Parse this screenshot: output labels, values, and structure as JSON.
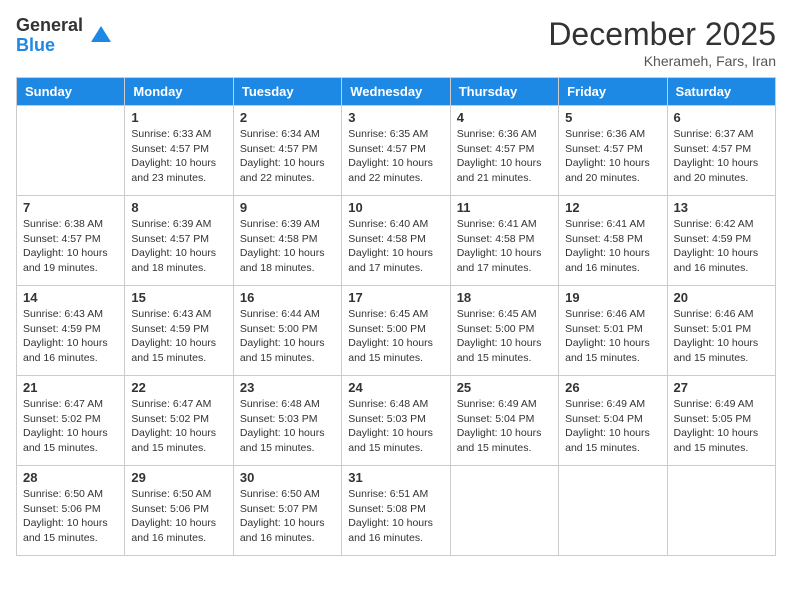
{
  "logo": {
    "general": "General",
    "blue": "Blue"
  },
  "header": {
    "month": "December 2025",
    "location": "Kherameh, Fars, Iran"
  },
  "days_of_week": [
    "Sunday",
    "Monday",
    "Tuesday",
    "Wednesday",
    "Thursday",
    "Friday",
    "Saturday"
  ],
  "weeks": [
    [
      {
        "day": "",
        "info": ""
      },
      {
        "day": "1",
        "info": "Sunrise: 6:33 AM\nSunset: 4:57 PM\nDaylight: 10 hours\nand 23 minutes."
      },
      {
        "day": "2",
        "info": "Sunrise: 6:34 AM\nSunset: 4:57 PM\nDaylight: 10 hours\nand 22 minutes."
      },
      {
        "day": "3",
        "info": "Sunrise: 6:35 AM\nSunset: 4:57 PM\nDaylight: 10 hours\nand 22 minutes."
      },
      {
        "day": "4",
        "info": "Sunrise: 6:36 AM\nSunset: 4:57 PM\nDaylight: 10 hours\nand 21 minutes."
      },
      {
        "day": "5",
        "info": "Sunrise: 6:36 AM\nSunset: 4:57 PM\nDaylight: 10 hours\nand 20 minutes."
      },
      {
        "day": "6",
        "info": "Sunrise: 6:37 AM\nSunset: 4:57 PM\nDaylight: 10 hours\nand 20 minutes."
      }
    ],
    [
      {
        "day": "7",
        "info": "Sunrise: 6:38 AM\nSunset: 4:57 PM\nDaylight: 10 hours\nand 19 minutes."
      },
      {
        "day": "8",
        "info": "Sunrise: 6:39 AM\nSunset: 4:57 PM\nDaylight: 10 hours\nand 18 minutes."
      },
      {
        "day": "9",
        "info": "Sunrise: 6:39 AM\nSunset: 4:58 PM\nDaylight: 10 hours\nand 18 minutes."
      },
      {
        "day": "10",
        "info": "Sunrise: 6:40 AM\nSunset: 4:58 PM\nDaylight: 10 hours\nand 17 minutes."
      },
      {
        "day": "11",
        "info": "Sunrise: 6:41 AM\nSunset: 4:58 PM\nDaylight: 10 hours\nand 17 minutes."
      },
      {
        "day": "12",
        "info": "Sunrise: 6:41 AM\nSunset: 4:58 PM\nDaylight: 10 hours\nand 16 minutes."
      },
      {
        "day": "13",
        "info": "Sunrise: 6:42 AM\nSunset: 4:59 PM\nDaylight: 10 hours\nand 16 minutes."
      }
    ],
    [
      {
        "day": "14",
        "info": "Sunrise: 6:43 AM\nSunset: 4:59 PM\nDaylight: 10 hours\nand 16 minutes."
      },
      {
        "day": "15",
        "info": "Sunrise: 6:43 AM\nSunset: 4:59 PM\nDaylight: 10 hours\nand 15 minutes."
      },
      {
        "day": "16",
        "info": "Sunrise: 6:44 AM\nSunset: 5:00 PM\nDaylight: 10 hours\nand 15 minutes."
      },
      {
        "day": "17",
        "info": "Sunrise: 6:45 AM\nSunset: 5:00 PM\nDaylight: 10 hours\nand 15 minutes."
      },
      {
        "day": "18",
        "info": "Sunrise: 6:45 AM\nSunset: 5:00 PM\nDaylight: 10 hours\nand 15 minutes."
      },
      {
        "day": "19",
        "info": "Sunrise: 6:46 AM\nSunset: 5:01 PM\nDaylight: 10 hours\nand 15 minutes."
      },
      {
        "day": "20",
        "info": "Sunrise: 6:46 AM\nSunset: 5:01 PM\nDaylight: 10 hours\nand 15 minutes."
      }
    ],
    [
      {
        "day": "21",
        "info": "Sunrise: 6:47 AM\nSunset: 5:02 PM\nDaylight: 10 hours\nand 15 minutes."
      },
      {
        "day": "22",
        "info": "Sunrise: 6:47 AM\nSunset: 5:02 PM\nDaylight: 10 hours\nand 15 minutes."
      },
      {
        "day": "23",
        "info": "Sunrise: 6:48 AM\nSunset: 5:03 PM\nDaylight: 10 hours\nand 15 minutes."
      },
      {
        "day": "24",
        "info": "Sunrise: 6:48 AM\nSunset: 5:03 PM\nDaylight: 10 hours\nand 15 minutes."
      },
      {
        "day": "25",
        "info": "Sunrise: 6:49 AM\nSunset: 5:04 PM\nDaylight: 10 hours\nand 15 minutes."
      },
      {
        "day": "26",
        "info": "Sunrise: 6:49 AM\nSunset: 5:04 PM\nDaylight: 10 hours\nand 15 minutes."
      },
      {
        "day": "27",
        "info": "Sunrise: 6:49 AM\nSunset: 5:05 PM\nDaylight: 10 hours\nand 15 minutes."
      }
    ],
    [
      {
        "day": "28",
        "info": "Sunrise: 6:50 AM\nSunset: 5:06 PM\nDaylight: 10 hours\nand 15 minutes."
      },
      {
        "day": "29",
        "info": "Sunrise: 6:50 AM\nSunset: 5:06 PM\nDaylight: 10 hours\nand 16 minutes."
      },
      {
        "day": "30",
        "info": "Sunrise: 6:50 AM\nSunset: 5:07 PM\nDaylight: 10 hours\nand 16 minutes."
      },
      {
        "day": "31",
        "info": "Sunrise: 6:51 AM\nSunset: 5:08 PM\nDaylight: 10 hours\nand 16 minutes."
      },
      {
        "day": "",
        "info": ""
      },
      {
        "day": "",
        "info": ""
      },
      {
        "day": "",
        "info": ""
      }
    ]
  ]
}
